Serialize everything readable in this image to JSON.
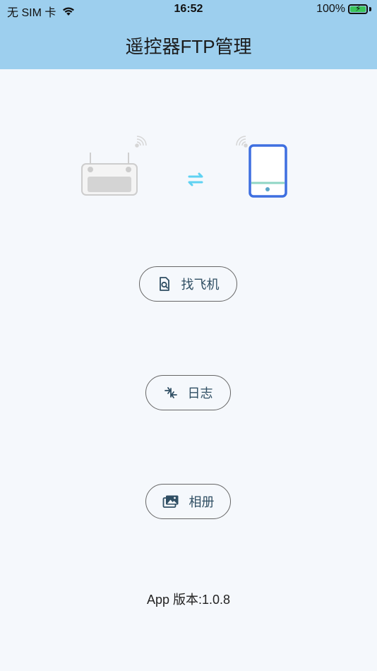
{
  "status_bar": {
    "carrier": "无 SIM 卡",
    "time": "16:52",
    "battery": "100%",
    "battery_level": 1.0
  },
  "header": {
    "title": "遥控器FTP管理"
  },
  "graphic": {
    "left_icon": "remote-controller-icon",
    "middle_icon": "sync-arrows-icon",
    "right_icon": "tablet-icon",
    "signal_icon": "signal-waves-icon"
  },
  "buttons": {
    "find_plane": {
      "label": "找飞机",
      "icon": "search-document-icon"
    },
    "log": {
      "label": "日志",
      "icon": "transfer-arrows-icon"
    },
    "album": {
      "label": "相册",
      "icon": "photo-album-icon"
    }
  },
  "footer": {
    "version": "App 版本:1.0.8"
  },
  "colors": {
    "header_bg": "#9dcfee",
    "page_bg": "#f5f8fc",
    "tablet_blue": "#3e6fe0",
    "sync_cyan": "#5fd2f2",
    "tablet_line": "#8fd6c4"
  }
}
